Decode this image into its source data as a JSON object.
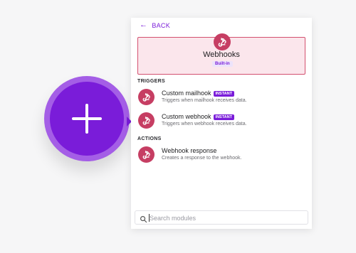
{
  "panel": {
    "back_label": "BACK",
    "app": {
      "title": "Webhooks",
      "badge": "Built-in",
      "icon": "webhook-icon"
    },
    "sections": {
      "triggers": "TRIGGERS",
      "actions": "ACTIONS"
    },
    "triggers": [
      {
        "name": "Custom mailhook",
        "badge": "INSTANT",
        "desc": "Triggers when mailhook receives data."
      },
      {
        "name": "Custom webhook",
        "badge": "INSTANT",
        "desc": "Triggers when webhook receives data."
      }
    ],
    "actions": [
      {
        "name": "Webhook response",
        "desc": "Creates a response to the webhook."
      }
    ],
    "search": {
      "placeholder": "Search modules",
      "value": ""
    }
  },
  "colors": {
    "accent": "#7a1cd9",
    "add_ring": "#a45ee6",
    "webhook_brand": "#c63e63",
    "app_card_bg": "#fbe6ec"
  }
}
